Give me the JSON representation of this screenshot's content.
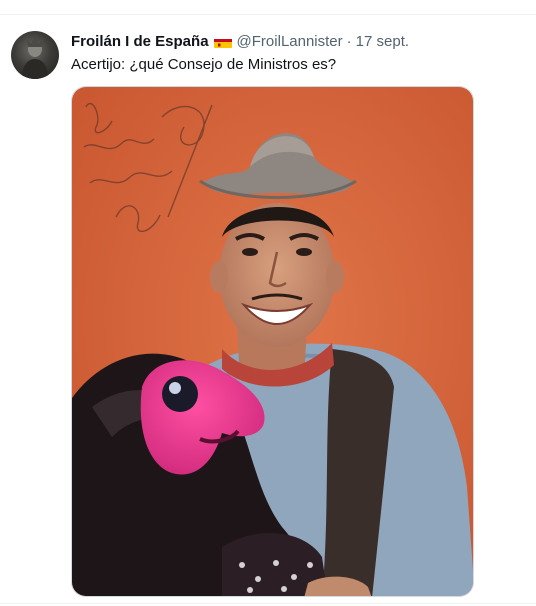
{
  "tweet": {
    "display_name": "Froilán I de España",
    "flag_icon": "spain-flag-icon",
    "handle": "@FroilLannister",
    "separator": "·",
    "time": "17 sept.",
    "text": "Acertijo: ¿qué Consejo de Ministros es?"
  },
  "colors": {
    "text_primary": "#0f1419",
    "text_secondary": "#536471",
    "photo_background": "#d4623a"
  }
}
